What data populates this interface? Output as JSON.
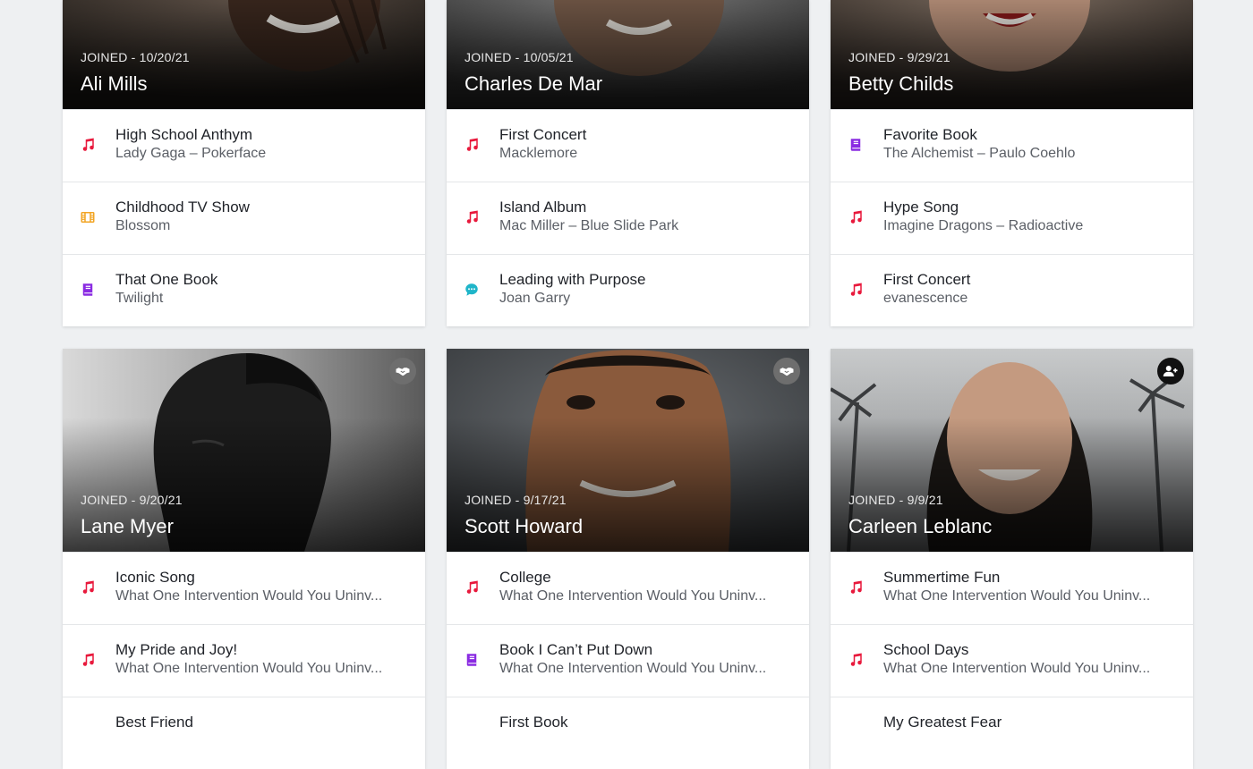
{
  "colors": {
    "music": "#e8193c",
    "book": "#8a2be2",
    "tv": "#f2a524",
    "chat": "#1fb5c9"
  },
  "cards": [
    {
      "joined": "JOINED - 10/20/21",
      "name": "Ali Mills",
      "items": [
        {
          "icon": "music-note-icon",
          "title": "High School Anthym",
          "subtitle": "Lady Gaga – Pokerface"
        },
        {
          "icon": "film-icon",
          "title": "Childhood TV Show",
          "subtitle": "Blossom"
        },
        {
          "icon": "book-icon",
          "title": "That One Book",
          "subtitle": "Twilight"
        }
      ]
    },
    {
      "joined": "JOINED - 10/05/21",
      "name": "Charles De Mar",
      "items": [
        {
          "icon": "music-note-icon",
          "title": "First Concert",
          "subtitle": "Macklemore"
        },
        {
          "icon": "music-note-icon",
          "title": "Island Album",
          "subtitle": "Mac Miller – Blue Slide Park"
        },
        {
          "icon": "chat-bubble-icon",
          "title": "Leading with Purpose",
          "subtitle": "Joan Garry"
        }
      ]
    },
    {
      "joined": "JOINED - 9/29/21",
      "name": "Betty Childs",
      "items": [
        {
          "icon": "book-icon",
          "title": "Favorite Book",
          "subtitle": "The Alchemist – Paulo Coehlo"
        },
        {
          "icon": "music-note-icon",
          "title": "Hype Song",
          "subtitle": "Imagine Dragons – Radioactive"
        },
        {
          "icon": "music-note-icon",
          "title": "First Concert",
          "subtitle": "evanescence"
        }
      ]
    },
    {
      "joined": "JOINED - 9/20/21",
      "name": "Lane Myer",
      "corner_icon": "handshake-icon",
      "items": [
        {
          "icon": "music-note-icon",
          "title": "Iconic Song",
          "subtitle": "What One Intervention Would You Uninv..."
        },
        {
          "icon": "music-note-icon",
          "title": "My Pride and Joy!",
          "subtitle": "What One Intervention Would You Uninv..."
        },
        {
          "icon": "",
          "title": "Best Friend",
          "subtitle": ""
        }
      ]
    },
    {
      "joined": "JOINED - 9/17/21",
      "name": "Scott Howard",
      "corner_icon": "handshake-icon",
      "items": [
        {
          "icon": "music-note-icon",
          "title": "College",
          "subtitle": "What One Intervention Would You Uninv..."
        },
        {
          "icon": "book-icon",
          "title": "Book I Can’t Put Down",
          "subtitle": "What One Intervention Would You Uninv..."
        },
        {
          "icon": "",
          "title": "First Book",
          "subtitle": ""
        }
      ]
    },
    {
      "joined": "JOINED - 9/9/21",
      "name": "Carleen Leblanc",
      "corner_icon": "add-user-icon",
      "items": [
        {
          "icon": "music-note-icon",
          "title": "Summertime Fun",
          "subtitle": "What One Intervention Would You Uninv..."
        },
        {
          "icon": "music-note-icon",
          "title": "School Days",
          "subtitle": "What One Intervention Would You Uninv..."
        },
        {
          "icon": "",
          "title": "My Greatest Fear",
          "subtitle": ""
        }
      ]
    }
  ]
}
